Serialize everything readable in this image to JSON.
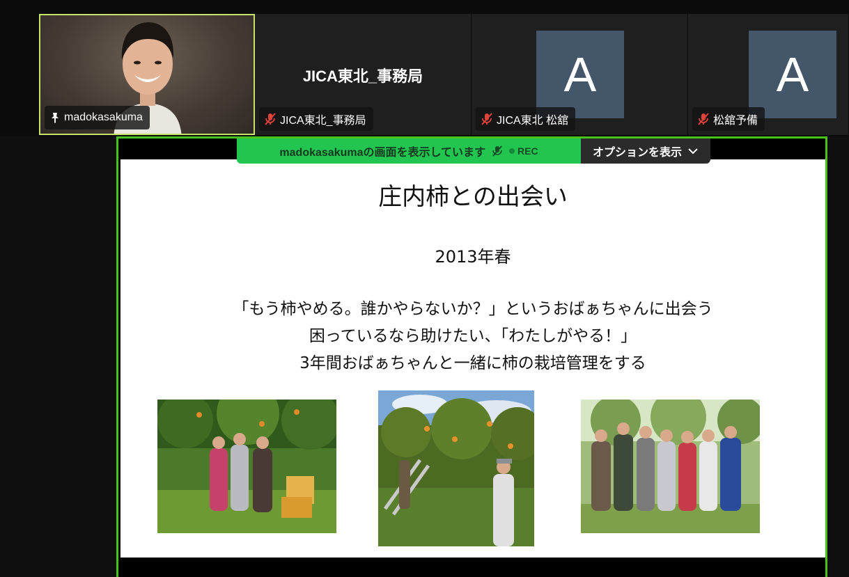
{
  "participants": [
    {
      "name": "madokasakuma",
      "has_video": true,
      "muted": false,
      "pinned": true
    },
    {
      "name": "JICA東北_事務局",
      "display_name": "JICA東北_事務局",
      "has_video": false,
      "muted": true
    },
    {
      "name": "JICA東北 松舘",
      "avatar_letter": "A",
      "has_video": false,
      "muted": true
    },
    {
      "name": "松舘予備",
      "avatar_letter": "A",
      "has_video": false,
      "muted": true
    }
  ],
  "share_banner": {
    "sharing_text": "madokasakumaの画面を表示しています",
    "rec_label": "REC",
    "options_label": "オプションを表示"
  },
  "slide": {
    "title": "庄内柿との出会い",
    "year": "2013年春",
    "lines": [
      "「もう柿やめる。誰かやらないか？」というおばぁちゃんに出会う",
      "困っているなら助けたい、「わたしがやる！」",
      "3年間おばぁちゃんと一緒に柿の栽培管理をする"
    ]
  },
  "colors": {
    "share_border": "#4ac21e",
    "banner_green": "#22c550",
    "active_speaker": "#c8e36a",
    "avatar_bg": "#44566a",
    "mute_red": "#e0433c"
  }
}
